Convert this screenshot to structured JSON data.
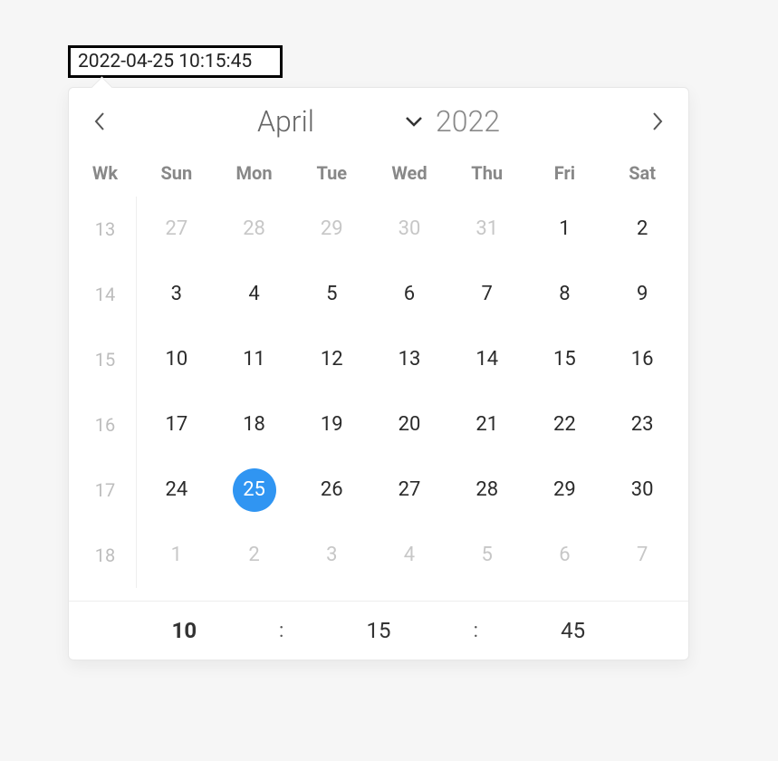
{
  "input": {
    "value": "2022-04-25 10:15:45"
  },
  "calendar": {
    "month_label": "April",
    "year_label": "2022",
    "week_header": "Wk",
    "day_headers": [
      "Sun",
      "Mon",
      "Tue",
      "Wed",
      "Thu",
      "Fri",
      "Sat"
    ],
    "weeks": [
      {
        "wk": "13",
        "days": [
          {
            "n": "27",
            "out": true
          },
          {
            "n": "28",
            "out": true
          },
          {
            "n": "29",
            "out": true
          },
          {
            "n": "30",
            "out": true
          },
          {
            "n": "31",
            "out": true
          },
          {
            "n": "1"
          },
          {
            "n": "2"
          }
        ]
      },
      {
        "wk": "14",
        "days": [
          {
            "n": "3"
          },
          {
            "n": "4"
          },
          {
            "n": "5"
          },
          {
            "n": "6"
          },
          {
            "n": "7"
          },
          {
            "n": "8"
          },
          {
            "n": "9"
          }
        ]
      },
      {
        "wk": "15",
        "days": [
          {
            "n": "10"
          },
          {
            "n": "11"
          },
          {
            "n": "12"
          },
          {
            "n": "13"
          },
          {
            "n": "14"
          },
          {
            "n": "15"
          },
          {
            "n": "16"
          }
        ]
      },
      {
        "wk": "16",
        "days": [
          {
            "n": "17"
          },
          {
            "n": "18"
          },
          {
            "n": "19"
          },
          {
            "n": "20"
          },
          {
            "n": "21"
          },
          {
            "n": "22"
          },
          {
            "n": "23"
          }
        ]
      },
      {
        "wk": "17",
        "days": [
          {
            "n": "24"
          },
          {
            "n": "25",
            "selected": true
          },
          {
            "n": "26"
          },
          {
            "n": "27"
          },
          {
            "n": "28"
          },
          {
            "n": "29"
          },
          {
            "n": "30"
          }
        ]
      },
      {
        "wk": "18",
        "days": [
          {
            "n": "1",
            "out": true
          },
          {
            "n": "2",
            "out": true
          },
          {
            "n": "3",
            "out": true
          },
          {
            "n": "4",
            "out": true
          },
          {
            "n": "5",
            "out": true
          },
          {
            "n": "6",
            "out": true
          },
          {
            "n": "7",
            "out": true
          }
        ]
      }
    ],
    "time": {
      "hour": "10",
      "minute": "15",
      "second": "45",
      "sep": ":"
    }
  }
}
